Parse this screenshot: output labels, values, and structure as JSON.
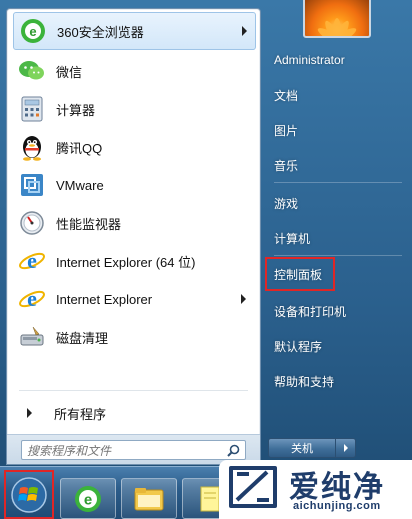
{
  "start_menu": {
    "programs": [
      {
        "label": "360安全浏览器",
        "icon": "browser-360-icon",
        "has_submenu": true
      },
      {
        "label": "微信",
        "icon": "wechat-icon",
        "has_submenu": false
      },
      {
        "label": "计算器",
        "icon": "calculator-icon",
        "has_submenu": false
      },
      {
        "label": "腾讯QQ",
        "icon": "qq-penguin-icon",
        "has_submenu": false
      },
      {
        "label": "VMware",
        "icon": "vmware-icon",
        "has_submenu": false
      },
      {
        "label": "性能监视器",
        "icon": "performance-monitor-icon",
        "has_submenu": false
      },
      {
        "label": "Internet Explorer (64 位)",
        "icon": "internet-explorer-icon",
        "has_submenu": false
      },
      {
        "label": "Internet Explorer",
        "icon": "internet-explorer-icon",
        "has_submenu": true
      },
      {
        "label": "磁盘清理",
        "icon": "disk-cleanup-icon",
        "has_submenu": false
      }
    ],
    "all_programs_label": "所有程序",
    "search_placeholder": "搜索程序和文件",
    "right_items": [
      {
        "label": "Administrator"
      },
      {
        "label": "文档"
      },
      {
        "label": "图片"
      },
      {
        "label": "音乐"
      },
      {
        "label": "游戏"
      },
      {
        "label": "计算机"
      },
      {
        "label": "控制面板"
      },
      {
        "label": "设备和打印机"
      },
      {
        "label": "默认程序"
      },
      {
        "label": "帮助和支持"
      }
    ],
    "shutdown_label": "关机",
    "highlighted_item": "控制面板"
  },
  "watermark": {
    "text": "爱纯净",
    "url": "aichunjing.com"
  },
  "colors": {
    "highlight_border": "#e02626",
    "panel_blue": "#2a5f8c"
  }
}
